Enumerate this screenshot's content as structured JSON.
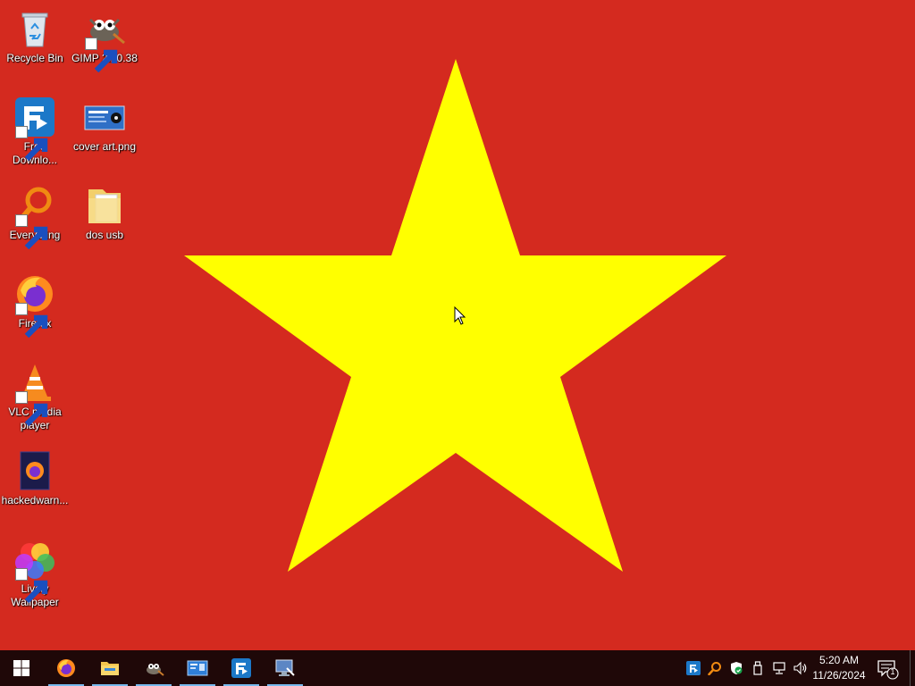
{
  "desktop": {
    "wallpaper_colors": {
      "background": "#d42a1f",
      "star": "#ffff00"
    },
    "icons": [
      {
        "label": "Recycle Bin",
        "icon": "recycle-bin-icon"
      },
      {
        "label": "GIMP 2.10.38",
        "icon": "gimp-icon"
      },
      {
        "label": "Free Downlo...",
        "icon": "free-download-manager-icon"
      },
      {
        "label": "cover art.png",
        "icon": "image-file-icon"
      },
      {
        "label": "Everything",
        "icon": "everything-search-icon"
      },
      {
        "label": "dos usb",
        "icon": "folder-icon"
      },
      {
        "label": "Firefox",
        "icon": "firefox-icon"
      },
      {
        "label": "VLC media player",
        "icon": "vlc-icon"
      },
      {
        "label": "hackedwarn...",
        "icon": "firefox-document-icon"
      },
      {
        "label": "Lively Wallpaper",
        "icon": "lively-wallpaper-icon"
      }
    ]
  },
  "taskbar": {
    "start_icon": "windows-logo-icon",
    "pinned": [
      {
        "icon": "firefox-icon"
      },
      {
        "icon": "file-explorer-icon"
      },
      {
        "icon": "gimp-icon"
      },
      {
        "icon": "image-viewer-icon"
      },
      {
        "icon": "free-download-manager-icon"
      },
      {
        "icon": "remote-desktop-icon"
      }
    ],
    "tray": [
      "free-download-manager-icon",
      "everything-search-icon",
      "windows-security-icon",
      "usb-device-icon",
      "network-icon",
      "volume-icon"
    ],
    "clock": {
      "time": "5:20 AM",
      "date": "11/26/2024"
    },
    "notifications": {
      "count": "1"
    }
  }
}
